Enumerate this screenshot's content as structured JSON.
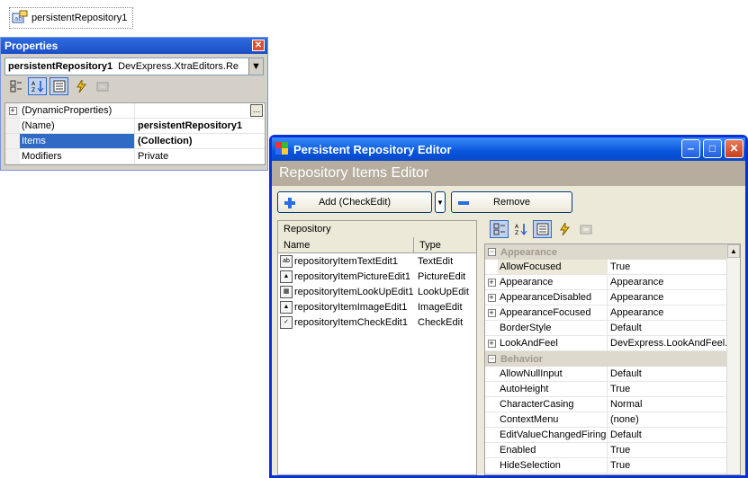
{
  "tray": {
    "component_label": "persistentRepository1"
  },
  "properties": {
    "title": "Properties",
    "object_name": "persistentRepository1",
    "object_type": "DevExpress.XtraEditors.Re",
    "rows": [
      {
        "name": "(DynamicProperties)",
        "value": "",
        "expandable": true
      },
      {
        "name": "(Name)",
        "value": "persistentRepository1",
        "bold": true
      },
      {
        "name": "Items",
        "value": "(Collection)",
        "bold": true,
        "selected": true
      },
      {
        "name": "Modifiers",
        "value": "Private"
      }
    ]
  },
  "editor": {
    "title": "Persistent Repository Editor",
    "caption": "Repository Items Editor",
    "add_label": "Add (CheckEdit)",
    "remove_label": "Remove",
    "repo_group": "Repository",
    "col_name": "Name",
    "col_type": "Type",
    "items": [
      {
        "name": "repositoryItemTextEdit1",
        "type": "TextEdit",
        "icon": "textedit-icon"
      },
      {
        "name": "repositoryItemPictureEdit1",
        "type": "PictureEdit",
        "icon": "pictureedit-icon"
      },
      {
        "name": "repositoryItemLookUpEdit1",
        "type": "LookUpEdit",
        "icon": "lookupedit-icon"
      },
      {
        "name": "repositoryItemImageEdit1",
        "type": "ImageEdit",
        "icon": "imageedit-icon"
      },
      {
        "name": "repositoryItemCheckEdit1",
        "type": "CheckEdit",
        "icon": "checkedit-icon"
      }
    ],
    "categories": [
      {
        "label": "Appearance",
        "rows": [
          {
            "name": "AllowFocused",
            "value": "True",
            "selected": true
          },
          {
            "name": "Appearance",
            "value": "Appearance",
            "expandable": true
          },
          {
            "name": "AppearanceDisabled",
            "value": "Appearance",
            "expandable": true
          },
          {
            "name": "AppearanceFocused",
            "value": "Appearance",
            "expandable": true
          },
          {
            "name": "BorderStyle",
            "value": "Default"
          },
          {
            "name": "LookAndFeel",
            "value": "DevExpress.LookAndFeel.U",
            "expandable": true
          }
        ]
      },
      {
        "label": "Behavior",
        "rows": [
          {
            "name": "AllowNullInput",
            "value": "Default"
          },
          {
            "name": "AutoHeight",
            "value": "True"
          },
          {
            "name": "CharacterCasing",
            "value": "Normal"
          },
          {
            "name": "ContextMenu",
            "value": "(none)"
          },
          {
            "name": "EditValueChangedFiringM",
            "value": "Default"
          },
          {
            "name": "Enabled",
            "value": "True"
          },
          {
            "name": "HideSelection",
            "value": "True"
          }
        ]
      }
    ]
  }
}
